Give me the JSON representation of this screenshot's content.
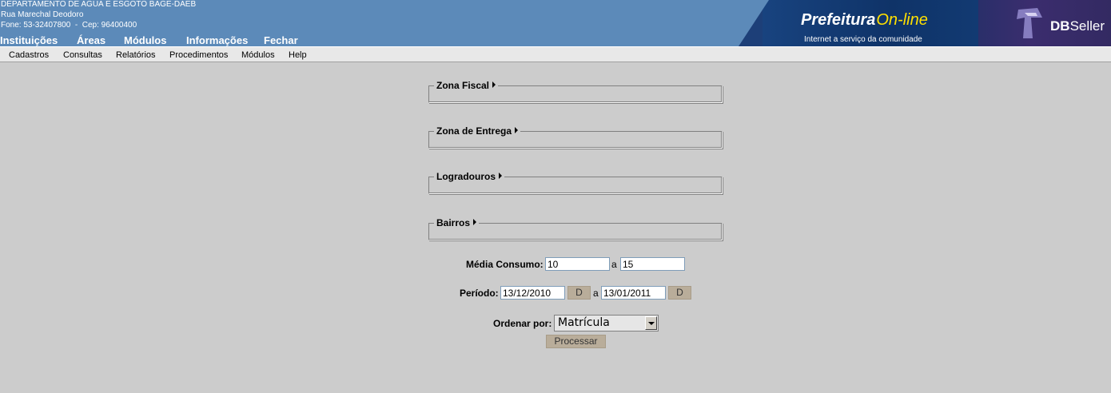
{
  "header": {
    "org_name": "DEPARTAMENTO DE AGUA E ESGOTO BAGE-DAEB",
    "address": "Rua Marechal Deodoro",
    "contact": "Fone: 53-32407800  -  Cep: 96400400",
    "nav": [
      "Instituições",
      "Áreas",
      "Módulos",
      "Informações",
      "Fechar"
    ]
  },
  "banner": {
    "brand_main": "Prefeitura",
    "brand_suffix": "On-line",
    "tagline": "Internet a serviço da comunidade",
    "db_logo_bold": "DB",
    "db_logo_light": "Seller"
  },
  "menu": [
    "Cadastros",
    "Consultas",
    "Relatórios",
    "Procedimentos",
    "Módulos",
    "Help"
  ],
  "filters": [
    {
      "label": "Zona Fiscal"
    },
    {
      "label": "Zona de Entrega"
    },
    {
      "label": "Logradouros"
    },
    {
      "label": "Bairros"
    }
  ],
  "media_consumo": {
    "label": "Média Consumo:",
    "from": "10",
    "sep": "a",
    "to": "15"
  },
  "periodo": {
    "label": "Período:",
    "from": "13/12/2010",
    "sep": "a",
    "to": "13/01/2011",
    "button": "D"
  },
  "ordenar": {
    "label": "Ordenar por:",
    "selected": "Matrícula"
  },
  "process_button": "Processar",
  "colors": {
    "header_bg": "#5c8ab9",
    "page_bg": "#cccccc",
    "button_bg": "#b9ad9a"
  }
}
